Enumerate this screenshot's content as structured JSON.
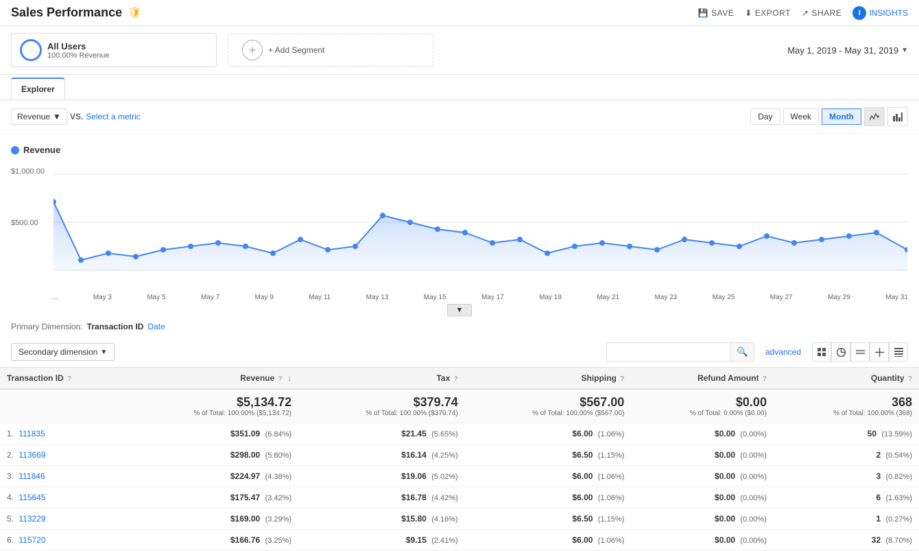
{
  "header": {
    "title": "Sales Performance",
    "actions": {
      "save": "SAVE",
      "export": "EXPORT",
      "share": "SHARE",
      "insights": "INSIGHTS"
    }
  },
  "segments": {
    "segment1": {
      "name": "All Users",
      "sub": "100.00% Revenue"
    },
    "add_label": "+ Add Segment"
  },
  "date_range": "May 1, 2019 - May 31, 2019",
  "tab": "Explorer",
  "metric": {
    "primary": "Revenue",
    "vs": "VS.",
    "select_label": "Select a metric"
  },
  "time_buttons": {
    "day": "Day",
    "week": "Week",
    "month": "Month"
  },
  "chart": {
    "legend": "Revenue",
    "y_labels": [
      "$1,000.00",
      "$500.00"
    ],
    "x_labels": [
      "...",
      "May 3",
      "May 5",
      "May 7",
      "May 9",
      "May 11",
      "May 13",
      "May 15",
      "May 17",
      "May 19",
      "May 21",
      "May 23",
      "May 25",
      "May 27",
      "May 29",
      "May 31"
    ]
  },
  "primary_dim": {
    "label": "Primary Dimension:",
    "transaction_id": "Transaction ID",
    "date": "Date"
  },
  "secondary_dim": {
    "label": "Secondary dimension"
  },
  "search": {
    "placeholder": "",
    "advanced": "advanced"
  },
  "table": {
    "headers": {
      "transaction_id": "Transaction ID",
      "revenue": "Revenue",
      "tax": "Tax",
      "shipping": "Shipping",
      "refund_amount": "Refund Amount",
      "quantity": "Quantity"
    },
    "totals": {
      "revenue_main": "$5,134.72",
      "revenue_sub": "% of Total: 100.00% ($5,134.72)",
      "tax_main": "$379.74",
      "tax_sub": "% of Total: 100.00% ($379.74)",
      "shipping_main": "$567.00",
      "shipping_sub": "% of Total: 100.00% ($567.00)",
      "refund_main": "$0.00",
      "refund_sub": "% of Total: 0.00% ($0.00)",
      "quantity_main": "368",
      "quantity_sub": "% of Total: 100.00% (368)"
    },
    "rows": [
      {
        "num": "1.",
        "id": "111835",
        "revenue": "$351.09",
        "revenue_pct": "(6.84%)",
        "tax": "$21.45",
        "tax_pct": "(5.65%)",
        "shipping": "$6.00",
        "shipping_pct": "(1.06%)",
        "refund": "$0.00",
        "refund_pct": "(0.00%)",
        "quantity": "50",
        "quantity_pct": "(13.59%)"
      },
      {
        "num": "2.",
        "id": "113669",
        "revenue": "$298.00",
        "revenue_pct": "(5.80%)",
        "tax": "$16.14",
        "tax_pct": "(4.25%)",
        "shipping": "$6.50",
        "shipping_pct": "(1.15%)",
        "refund": "$0.00",
        "refund_pct": "(0.00%)",
        "quantity": "2",
        "quantity_pct": "(0.54%)"
      },
      {
        "num": "3.",
        "id": "111846",
        "revenue": "$224.97",
        "revenue_pct": "(4.38%)",
        "tax": "$19.06",
        "tax_pct": "(5.02%)",
        "shipping": "$6.00",
        "shipping_pct": "(1.06%)",
        "refund": "$0.00",
        "refund_pct": "(0.00%)",
        "quantity": "3",
        "quantity_pct": "(0.82%)"
      },
      {
        "num": "4.",
        "id": "115645",
        "revenue": "$175.47",
        "revenue_pct": "(3.42%)",
        "tax": "$16.78",
        "tax_pct": "(4.42%)",
        "shipping": "$6.00",
        "shipping_pct": "(1.06%)",
        "refund": "$0.00",
        "refund_pct": "(0.00%)",
        "quantity": "6",
        "quantity_pct": "(1.63%)"
      },
      {
        "num": "5.",
        "id": "113229",
        "revenue": "$169.00",
        "revenue_pct": "(3.29%)",
        "tax": "$15.80",
        "tax_pct": "(4.16%)",
        "shipping": "$6.50",
        "shipping_pct": "(1.15%)",
        "refund": "$0.00",
        "refund_pct": "(0.00%)",
        "quantity": "1",
        "quantity_pct": "(0.27%)"
      },
      {
        "num": "6.",
        "id": "115720",
        "revenue": "$166.76",
        "revenue_pct": "(3.25%)",
        "tax": "$9.15",
        "tax_pct": "(2.41%)",
        "shipping": "$6.00",
        "shipping_pct": "(1.06%)",
        "refund": "$0.00",
        "refund_pct": "(0.00%)",
        "quantity": "32",
        "quantity_pct": "(8.70%)"
      }
    ]
  },
  "colors": {
    "blue": "#4285f4",
    "chart_fill": "rgba(66,133,244,0.15)",
    "chart_line": "#4285f4"
  }
}
